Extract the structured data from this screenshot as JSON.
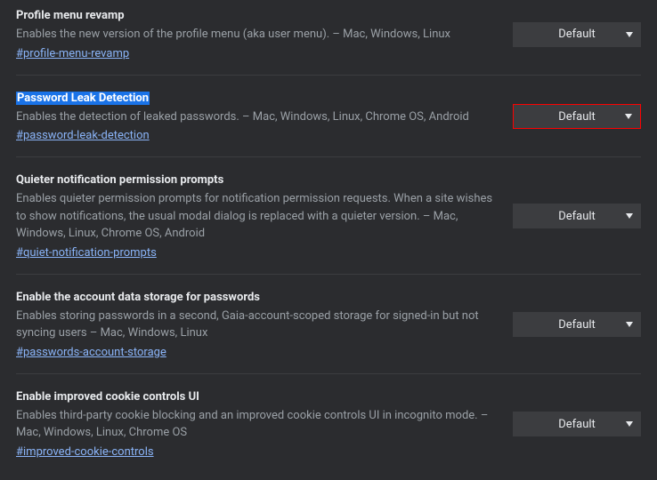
{
  "flags": [
    {
      "title": "Profile menu revamp",
      "description": "Enables the new version of the profile menu (aka user menu). – Mac, Windows, Linux",
      "anchor": "#profile-menu-revamp",
      "dropdown": "Default",
      "highlighted": false,
      "selected": false
    },
    {
      "title": "Password Leak Detection",
      "description": "Enables the detection of leaked passwords. – Mac, Windows, Linux, Chrome OS, Android",
      "anchor": "#password-leak-detection",
      "dropdown": "Default",
      "highlighted": true,
      "selected": true
    },
    {
      "title": "Quieter notification permission prompts",
      "description": "Enables quieter permission prompts for notification permission requests. When a site wishes to show notifications, the usual modal dialog is replaced with a quieter version. – Mac, Windows, Linux, Chrome OS, Android",
      "anchor": "#quiet-notification-prompts",
      "dropdown": "Default",
      "highlighted": false,
      "selected": false
    },
    {
      "title": "Enable the account data storage for passwords",
      "description": "Enables storing passwords in a second, Gaia-account-scoped storage for signed-in but not syncing users – Mac, Windows, Linux",
      "anchor": "#passwords-account-storage",
      "dropdown": "Default",
      "highlighted": false,
      "selected": false
    },
    {
      "title": "Enable improved cookie controls UI",
      "description": "Enables third-party cookie blocking and an improved cookie controls UI in incognito mode. – Mac, Windows, Linux, Chrome OS",
      "anchor": "#improved-cookie-controls",
      "dropdown": "Default",
      "highlighted": false,
      "selected": false
    }
  ]
}
